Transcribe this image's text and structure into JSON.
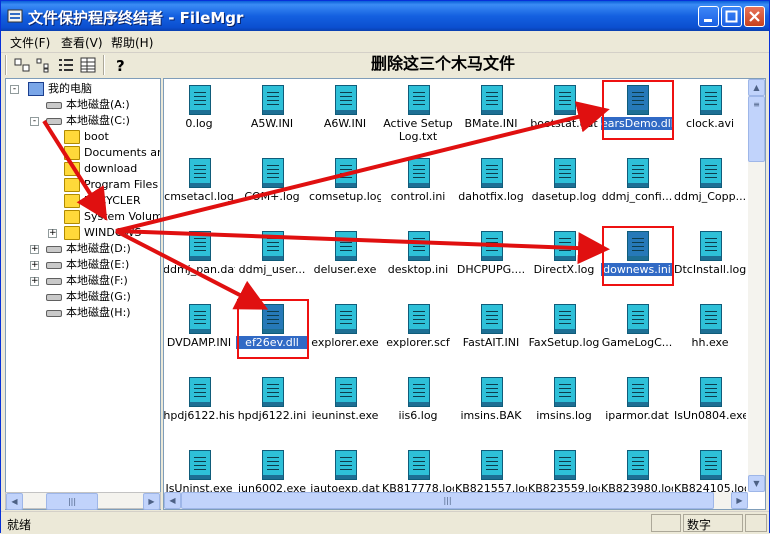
{
  "window": {
    "title": "文件保护程序终结者 - FileMgr"
  },
  "menu": [
    "文件(F)",
    "查看(V)",
    "帮助(H)"
  ],
  "toolbar": {
    "buttons": [
      "large-icons",
      "small-icons",
      "list",
      "details",
      "help"
    ]
  },
  "annotation": "删除这三个木马文件",
  "tree": [
    {
      "label": "我的电脑",
      "kind": "computer",
      "depth": 0,
      "expander": "-"
    },
    {
      "label": "本地磁盘(A:)",
      "kind": "drive",
      "depth": 1,
      "expander": ""
    },
    {
      "label": "本地磁盘(C:)",
      "kind": "drive",
      "depth": 1,
      "expander": "-"
    },
    {
      "label": "boot",
      "kind": "folder",
      "depth": 2,
      "expander": ""
    },
    {
      "label": "Documents and",
      "kind": "folder",
      "depth": 2,
      "expander": ""
    },
    {
      "label": "download",
      "kind": "folder",
      "depth": 2,
      "expander": ""
    },
    {
      "label": "Program Files",
      "kind": "folder",
      "depth": 2,
      "expander": ""
    },
    {
      "label": "RECYCLER",
      "kind": "folder",
      "depth": 2,
      "expander": ""
    },
    {
      "label": "System Volume",
      "kind": "folder",
      "depth": 2,
      "expander": ""
    },
    {
      "label": "WINDOWS",
      "kind": "folder",
      "depth": 2,
      "expander": "+"
    },
    {
      "label": "本地磁盘(D:)",
      "kind": "drive",
      "depth": 1,
      "expander": "+"
    },
    {
      "label": "本地磁盘(E:)",
      "kind": "drive",
      "depth": 1,
      "expander": "+"
    },
    {
      "label": "本地磁盘(F:)",
      "kind": "drive",
      "depth": 1,
      "expander": "+"
    },
    {
      "label": "本地磁盘(G:)",
      "kind": "drive",
      "depth": 1,
      "expander": ""
    },
    {
      "label": "本地磁盘(H:)",
      "kind": "drive",
      "depth": 1,
      "expander": ""
    }
  ],
  "files": [
    {
      "name": "0.log"
    },
    {
      "name": "A5W.INI"
    },
    {
      "name": "A6W.INI"
    },
    {
      "name": "Active Setup Log.txt"
    },
    {
      "name": "BMate.INI"
    },
    {
      "name": "bootstat.dat"
    },
    {
      "name": "earsDemo.dll",
      "selected": true
    },
    {
      "name": "clock.avi"
    },
    {
      "name": "cmsetacl.log"
    },
    {
      "name": "COM+.log"
    },
    {
      "name": "comsetup.log"
    },
    {
      "name": "control.ini"
    },
    {
      "name": "dahotfix.log"
    },
    {
      "name": "dasetup.log"
    },
    {
      "name": "ddmj_confi..."
    },
    {
      "name": "ddmj_Copp..."
    },
    {
      "name": "ddmj_pan.dat"
    },
    {
      "name": "ddmj_user..."
    },
    {
      "name": "deluser.exe"
    },
    {
      "name": "desktop.ini"
    },
    {
      "name": "DHCPUPG...."
    },
    {
      "name": "DirectX.log"
    },
    {
      "name": "downews.ini",
      "selected": true
    },
    {
      "name": "DtcInstall.log"
    },
    {
      "name": "DVDAMP.INI"
    },
    {
      "name": "ef26ev.dll",
      "selected": true
    },
    {
      "name": "explorer.exe"
    },
    {
      "name": "explorer.scf"
    },
    {
      "name": "FastAIT.INI"
    },
    {
      "name": "FaxSetup.log"
    },
    {
      "name": "GameLogC..."
    },
    {
      "name": "hh.exe"
    },
    {
      "name": "hpdj6122.his"
    },
    {
      "name": "hpdj6122.ini"
    },
    {
      "name": "ieuninst.exe"
    },
    {
      "name": "iis6.log"
    },
    {
      "name": "imsins.BAK"
    },
    {
      "name": "imsins.log"
    },
    {
      "name": "iparmor.dat"
    },
    {
      "name": "IsUn0804.exe"
    },
    {
      "name": "IsUninst.exe"
    },
    {
      "name": "iun6002.exe"
    },
    {
      "name": "jautoexp.dat"
    },
    {
      "name": "KB817778.log"
    },
    {
      "name": "KB821557.log"
    },
    {
      "name": "KB823559.log"
    },
    {
      "name": "KB823980.log"
    },
    {
      "name": "KB824105.log"
    }
  ],
  "status": {
    "text": "就绪",
    "mode": "数字"
  },
  "colors": {
    "titlebar": "#0a5fd8",
    "selection": "#316ac5",
    "annotation_red": "#e01010"
  }
}
